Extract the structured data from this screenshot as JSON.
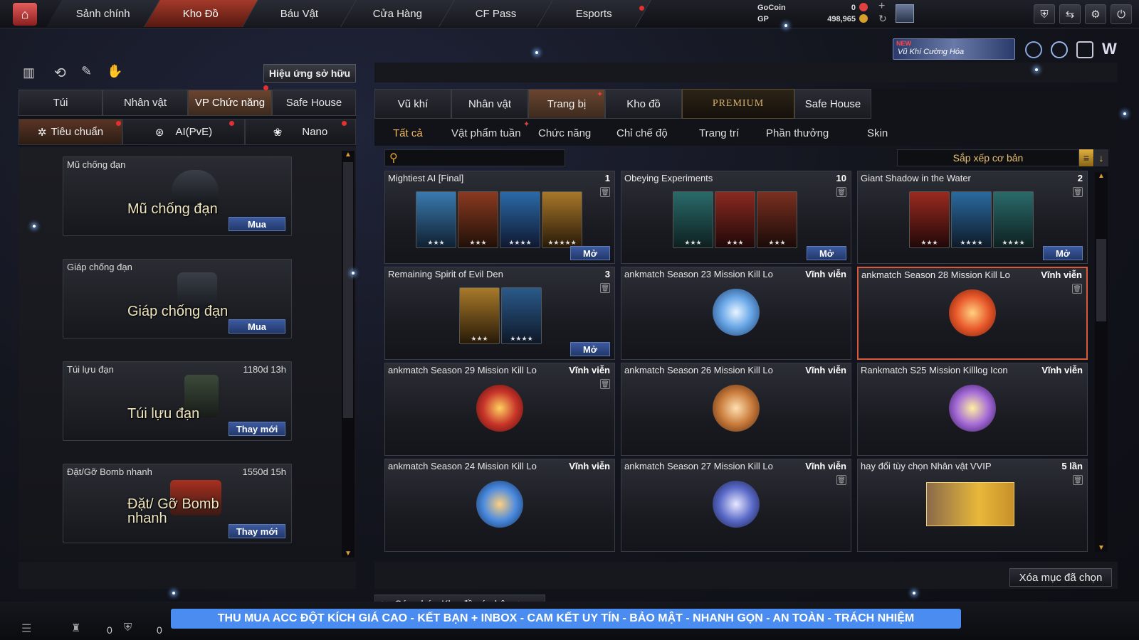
{
  "topnav": {
    "tabs": [
      "Sảnh chính",
      "Kho Đồ",
      "Báu Vật",
      "Cửa Hàng",
      "CF Pass",
      "Esports"
    ],
    "currency": {
      "gocoin_label": "GoCoin",
      "gocoin_value": "0",
      "gp_label": "GP",
      "gp_value": "498,965"
    }
  },
  "promo": {
    "new_tag": "NEW",
    "text": "Vũ Khí Cường Hóa"
  },
  "left": {
    "effect_button": "Hiệu ứng sở hữu",
    "tabs": [
      "Túi",
      "Nhân vật",
      "VP Chức năng",
      "Safe House"
    ],
    "subtabs": [
      "Tiêu chuẩn",
      "AI(PvE)",
      "Nano"
    ],
    "items": [
      {
        "title": "Mũ chống đạn",
        "duration": "",
        "overlay": "Mũ chống đạn",
        "button": "Mua"
      },
      {
        "title": "Giáp chống đạn",
        "duration": "",
        "overlay": "Giáp chống đạn",
        "button": "Mua"
      },
      {
        "title": "Túi lựu đạn",
        "duration": "1180d 13h",
        "overlay": "Túi lựu đạn",
        "button": "Thay mới"
      },
      {
        "title": "Đặt/Gỡ Bomb nhanh",
        "duration": "1550d 15h",
        "overlay": "Đặt/ Gỡ Bomb nhanh",
        "button": "Thay mới"
      }
    ]
  },
  "right": {
    "tabs": [
      "Vũ khí",
      "Nhân vật",
      "Trang bị",
      "Kho đồ",
      "PREMIUM",
      "Safe House"
    ],
    "categories": [
      "Tất cả",
      "Vật phẩm tuần",
      "Chức năng",
      "Chỉ chế độ",
      "Trang trí",
      "Phần thưởng",
      "Skin"
    ],
    "sort_label": "Sắp xếp cơ bản",
    "search_placeholder": "",
    "items": [
      {
        "name": "Mightiest AI [Final]",
        "count": "1",
        "button": "Mở",
        "thumbs": [
          {
            "stars": "★★★",
            "color": "#1d5e8a"
          },
          {
            "stars": "★★★",
            "color": "#5a2a1a"
          },
          {
            "stars": "★★★★",
            "color": "#1d4a7a"
          },
          {
            "stars": "★★★★★",
            "color": "#6a4a1a"
          }
        ]
      },
      {
        "name": "Obeying Experiments",
        "count": "10",
        "button": "Mở",
        "thumbs": [
          {
            "stars": "★★★",
            "color": "#1f4a4a"
          },
          {
            "stars": "★★★",
            "color": "#5a2018"
          },
          {
            "stars": "★★★",
            "color": "#4a2218"
          }
        ]
      },
      {
        "name": "Giant Shadow in the Water",
        "count": "2",
        "button": "Mở",
        "thumbs": [
          {
            "stars": "★★★",
            "color": "#5a1a18"
          },
          {
            "stars": "★★★★",
            "color": "#1d4a6a"
          },
          {
            "stars": "★★★★",
            "color": "#2a4a4a"
          }
        ]
      },
      {
        "name": "Remaining Spirit of Evil Den",
        "count": "3",
        "button": "Mở",
        "thumbs": [
          {
            "stars": "★★★",
            "color": "#6a4a1a"
          },
          {
            "stars": "★★★★",
            "color": "#1d3a5a"
          }
        ]
      },
      {
        "name": "ankmatch Season 23 Mission Kill Lo",
        "count": "Vĩnh viễn",
        "emblem": "#6aa8e8"
      },
      {
        "name": "ankmatch Season 28 Mission Kill Lo",
        "count": "Vĩnh viễn",
        "emblem": "#e8582a"
      },
      {
        "name": "ankmatch Season 29 Mission Kill Lo",
        "count": "Vĩnh viễn",
        "emblem": "#c8352a"
      },
      {
        "name": "ankmatch Season 26 Mission Kill Lo",
        "count": "Vĩnh viễn",
        "emblem": "#c87a3a"
      },
      {
        "name": "Rankmatch S25 Mission Killlog Icon",
        "count": "Vĩnh viễn",
        "emblem": "#a46ad8"
      },
      {
        "name": "ankmatch Season 24 Mission Kill Lo",
        "count": "Vĩnh viễn",
        "emblem": "#4a8ae0"
      },
      {
        "name": "ankmatch Season 27 Mission Kill Lo",
        "count": "Vĩnh viễn",
        "emblem": "#5a6ac8"
      },
      {
        "name": "hay đổi tùy chọn Nhân vật VVIP",
        "count": "5 lần",
        "emblem": "#e8b83a"
      }
    ],
    "delete_selected": "Xóa mục đã chọn",
    "capacity_label": "Sức chứa Kho đồ cá nhân"
  },
  "bottom": {
    "count1": "0",
    "count2": "0",
    "banner": "THU MUA ACC ĐỘT KÍCH GIÁ CAO  -  KẾT BẠN + INBOX  -  CAM KẾT UY TÍN - BẢO MẬT - NHANH GỌN - AN TOÀN - TRÁCH NHIỆM"
  }
}
